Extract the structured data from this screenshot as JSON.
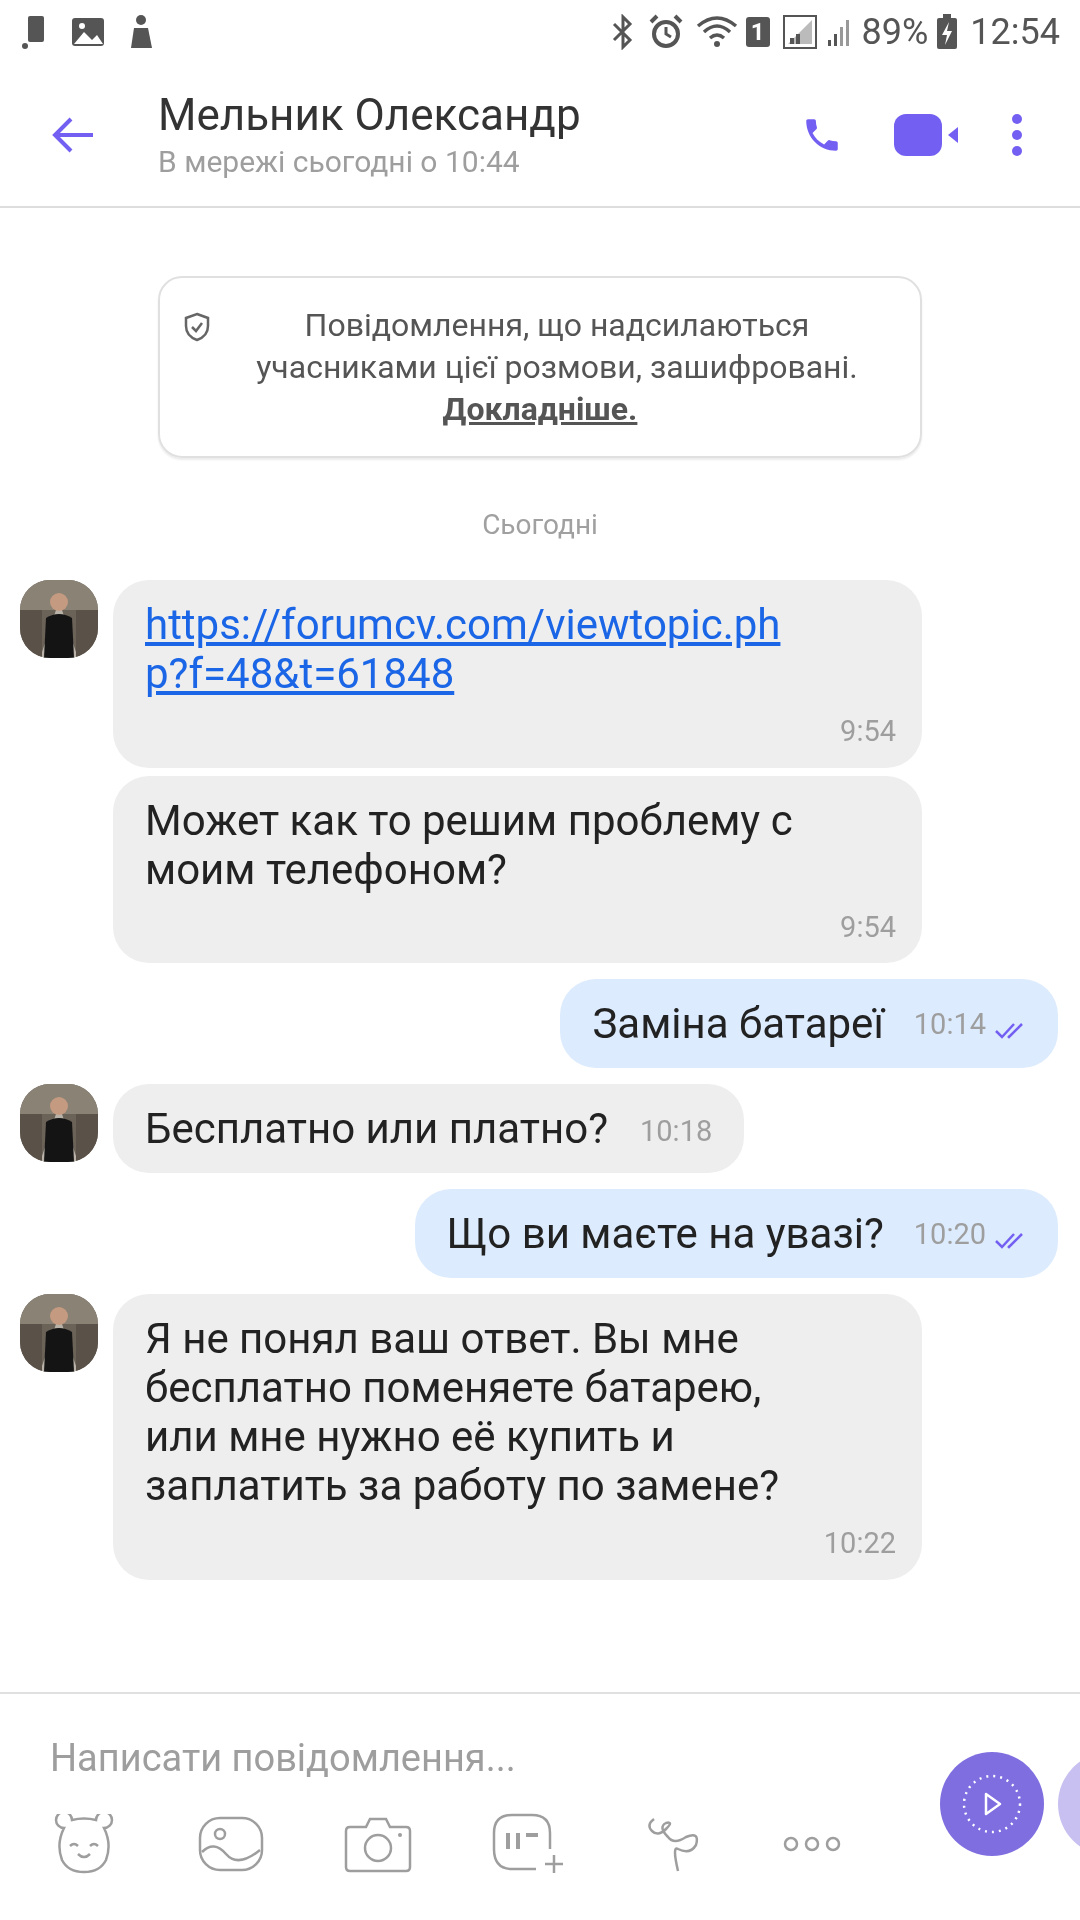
{
  "status_bar": {
    "sim_badge": "1",
    "battery": "89%",
    "time": "12:54"
  },
  "header": {
    "title": "Мельник Олександр",
    "subtitle": "В мережі сьогодні о 10:44"
  },
  "notice": {
    "text": "Повідомлення, що надсилаються учасниками цієї розмови, зашифровані.",
    "link": "Докладніше."
  },
  "date_separator": "Сьогодні",
  "messages": [
    {
      "kind": "incoming",
      "avatar": true,
      "link": "https://forumcv.com/viewtopic.php?f=48&t=61848",
      "time": "9:54"
    },
    {
      "kind": "incoming",
      "avatar": false,
      "text": "Может как то решим проблему с моим телефоном?",
      "time": "9:54"
    },
    {
      "kind": "outgoing",
      "text": "Заміна батареї",
      "time": "10:14",
      "read": true
    },
    {
      "kind": "incoming",
      "avatar": true,
      "text": "Бесплатно или платно?",
      "time": "10:18"
    },
    {
      "kind": "outgoing",
      "text": "Що ви маєте на увазі?",
      "time": "10:20",
      "read": true
    },
    {
      "kind": "incoming",
      "avatar": true,
      "text": "Я не понял ваш ответ. Вы мне бесплатно поменяете батарею, или мне нужно её купить и заплатить за работу по замене?",
      "time": "10:22"
    }
  ],
  "composer": {
    "placeholder": "Написати повідомлення..."
  }
}
